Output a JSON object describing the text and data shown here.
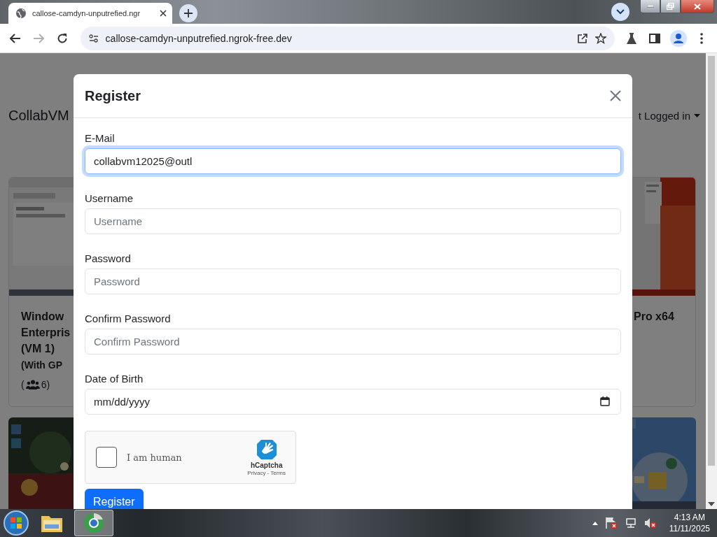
{
  "browser": {
    "tab_title": "callose-camdyn-unputrefied.ngr",
    "address": "callose-camdyn-unputrefied.ngrok-free.dev",
    "forward_disabled": true
  },
  "page": {
    "brand": "CollabVM",
    "account_menu": "t Logged in",
    "vm_cards": [
      {
        "title": "Window Enterpris (VM 1)",
        "subtitle": "(With GP",
        "paren_open": "(",
        "viewers": "6",
        "paren_close": ")"
      },
      {
        "title": "Pro x64"
      }
    ]
  },
  "modal": {
    "title": "Register",
    "fields": [
      {
        "kind": "text",
        "label": "E-Mail",
        "value": "collabvm12025@outl",
        "focused": true
      },
      {
        "kind": "text",
        "label": "Username",
        "placeholder": "Username",
        "focused": false
      },
      {
        "kind": "password",
        "label": "Password",
        "placeholder": "Password",
        "focused": false
      },
      {
        "kind": "password",
        "label": "Confirm Password",
        "placeholder": "Confirm Password",
        "focused": false
      },
      {
        "kind": "date",
        "label": "Date of Birth",
        "placeholder": "mm/dd/yyyy",
        "focused": false
      }
    ],
    "captcha": {
      "label": "I am human",
      "checked": false,
      "brand": "hCaptcha",
      "privacy_link": "Privacy",
      "separator": "-",
      "terms_link": "Terms"
    },
    "submit": "Register"
  },
  "taskbar": {
    "apps": [
      {
        "kind": "explorer",
        "selected": false
      },
      {
        "kind": "chrome",
        "selected": true
      }
    ],
    "time": "4:13 AM",
    "date": "11/11/2025"
  }
}
